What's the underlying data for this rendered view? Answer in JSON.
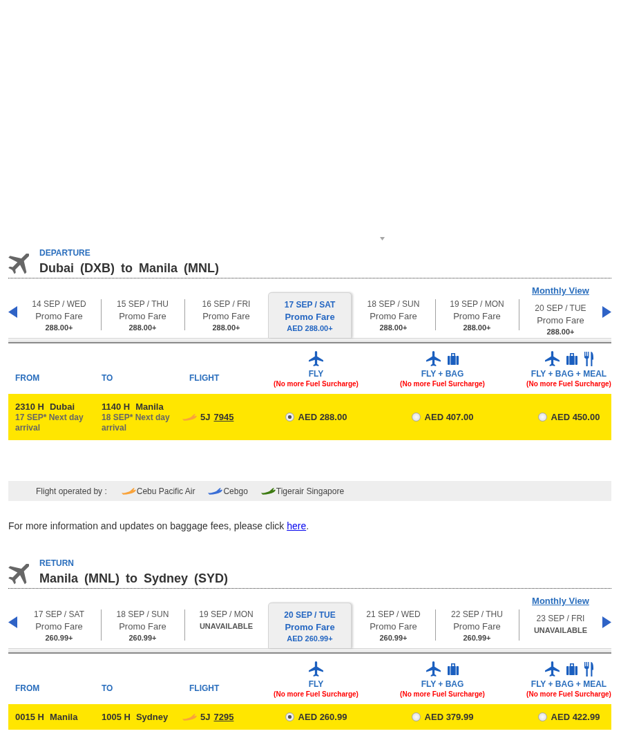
{
  "departure": {
    "label": "DEPARTURE",
    "route": "Dubai (DXB) to Manila (MNL)",
    "monthly_view": "Monthly View",
    "dates": [
      {
        "date": "14 SEP / WED",
        "fare": "Promo Fare",
        "price": "288.00+",
        "selected": false
      },
      {
        "date": "15 SEP / THU",
        "fare": "Promo Fare",
        "price": "288.00+",
        "selected": false
      },
      {
        "date": "16 SEP / FRI",
        "fare": "Promo Fare",
        "price": "288.00+",
        "selected": false
      },
      {
        "date": "17 SEP / SAT",
        "fare": "Promo Fare",
        "price": "AED 288.00+",
        "selected": true
      },
      {
        "date": "18 SEP / SUN",
        "fare": "Promo Fare",
        "price": "288.00+",
        "selected": false
      },
      {
        "date": "19 SEP / MON",
        "fare": "Promo Fare",
        "price": "288.00+",
        "selected": false
      },
      {
        "date": "20 SEP / TUE",
        "fare": "Promo Fare",
        "price": "288.00+",
        "selected": false
      }
    ],
    "columns": [
      "FROM",
      "TO",
      "FLIGHT"
    ],
    "fare_columns": [
      {
        "kind": "fly",
        "label": "FLY",
        "note": "(No more Fuel Surcharge)"
      },
      {
        "kind": "fly_bag",
        "label": "FLY + BAG",
        "note": "(No more Fuel Surcharge)"
      },
      {
        "kind": "fly_bag_meal",
        "label": "FLY + BAG + MEAL",
        "note": "(No more Fuel Surcharge)"
      }
    ],
    "flights": [
      {
        "from": {
          "time": "2310 H",
          "city": "Dubai",
          "note": "17 SEP* Next day arrival"
        },
        "to": {
          "time": "1140 H",
          "city": "Manila",
          "note": "18 SEP* Next day arrival"
        },
        "carrier": "5J",
        "number": "7945",
        "color": "#f9a33b",
        "fares": [
          {
            "price": "AED 288.00",
            "selected": true
          },
          {
            "price": "AED 407.00",
            "selected": false
          },
          {
            "price": "AED 450.00",
            "selected": false
          }
        ]
      }
    ]
  },
  "operated_by": {
    "label": "Flight operated by :",
    "carriers": [
      {
        "name": "Cebu Pacific Air",
        "color": "#f9a33b"
      },
      {
        "name": "Cebgo",
        "color": "#3b6fd6"
      },
      {
        "name": "Tigerair Singapore",
        "color": "#3e7b12"
      }
    ]
  },
  "baggage_info": {
    "text": "For more information and updates on baggage fees, please click ",
    "link": "here",
    "after": "."
  },
  "return": {
    "label": "RETURN",
    "route": "Manila (MNL) to Sydney (SYD)",
    "monthly_view": "Monthly View",
    "dates": [
      {
        "date": "17 SEP / SAT",
        "fare": "Promo Fare",
        "price": "260.99+",
        "selected": false
      },
      {
        "date": "18 SEP / SUN",
        "fare": "Promo Fare",
        "price": "260.99+",
        "selected": false
      },
      {
        "date": "19 SEP / MON",
        "status": "UNAVAILABLE",
        "selected": false
      },
      {
        "date": "20 SEP / TUE",
        "fare": "Promo Fare",
        "price": "AED 260.99+",
        "selected": true
      },
      {
        "date": "21 SEP / WED",
        "fare": "Promo Fare",
        "price": "260.99+",
        "selected": false
      },
      {
        "date": "22 SEP / THU",
        "fare": "Promo Fare",
        "price": "260.99+",
        "selected": false
      },
      {
        "date": "23 SEP / FRI",
        "status": "UNAVAILABLE",
        "selected": false
      }
    ],
    "columns": [
      "FROM",
      "TO",
      "FLIGHT"
    ],
    "fare_columns": [
      {
        "kind": "fly",
        "label": "FLY",
        "note": "(No more Fuel Surcharge)"
      },
      {
        "kind": "fly_bag",
        "label": "FLY + BAG",
        "note": "(No more Fuel Surcharge)"
      },
      {
        "kind": "fly_bag_meal",
        "label": "FLY + BAG + MEAL",
        "note": "(No more Fuel Surcharge)"
      }
    ],
    "flights": [
      {
        "from": {
          "time": "0015 H",
          "city": "Manila"
        },
        "to": {
          "time": "1005 H",
          "city": "Sydney"
        },
        "carrier": "5J",
        "number": "7295",
        "color": "#f9a33b",
        "fares": [
          {
            "price": "AED 260.99",
            "selected": true
          },
          {
            "price": "AED 379.99",
            "selected": false
          },
          {
            "price": "AED 422.99",
            "selected": false
          }
        ]
      }
    ]
  }
}
